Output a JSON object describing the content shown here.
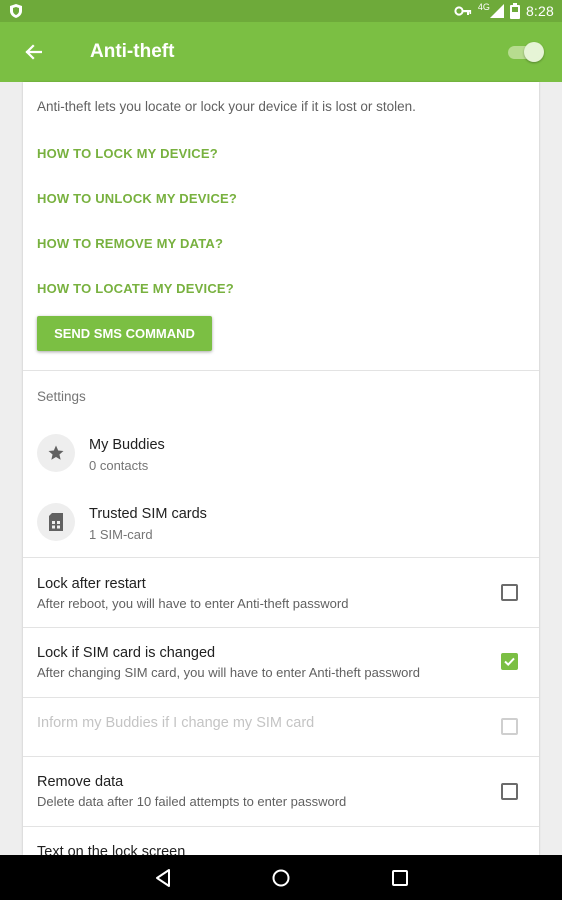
{
  "status_bar": {
    "time": "8:28",
    "network": "4G",
    "icons": [
      "shield-icon",
      "vpn-key-icon",
      "signal-icon",
      "battery-icon"
    ]
  },
  "app_bar": {
    "title": "Anti-theft",
    "toggle_on": true,
    "colors": {
      "primary": "#7bbf43",
      "status_bar": "#6eaa3a"
    }
  },
  "intro": "Anti-theft lets you locate or lock your device if it is lost or stolen.",
  "howto_links": [
    "HOW TO LOCK MY DEVICE?",
    "HOW TO UNLOCK MY DEVICE?",
    "HOW TO REMOVE MY DATA?",
    "HOW TO LOCATE MY DEVICE?"
  ],
  "sms_button": "SEND SMS COMMAND",
  "settings_label": "Settings",
  "items": [
    {
      "title": "My Buddies",
      "subtitle": "0 contacts",
      "icon": "star-icon"
    },
    {
      "title": "Trusted SIM cards",
      "subtitle": "1 SIM-card",
      "icon": "sim-card-icon"
    }
  ],
  "prefs": [
    {
      "title": "Lock after restart",
      "subtitle": "After reboot, you will have to enter Anti-theft password",
      "checked": false,
      "enabled": true
    },
    {
      "title": "Lock if SIM card is changed",
      "subtitle": "After changing SIM card, you will have to enter Anti-theft password",
      "checked": true,
      "enabled": true
    },
    {
      "title": "Inform my Buddies if I change my SIM card",
      "checked": false,
      "enabled": false
    },
    {
      "title": "Remove data",
      "subtitle": "Delete data after 10 failed attempts to enter password",
      "checked": false,
      "enabled": true
    },
    {
      "title": "Text on the lock screen"
    }
  ],
  "nav": [
    "back-icon",
    "home-icon",
    "recents-icon"
  ]
}
